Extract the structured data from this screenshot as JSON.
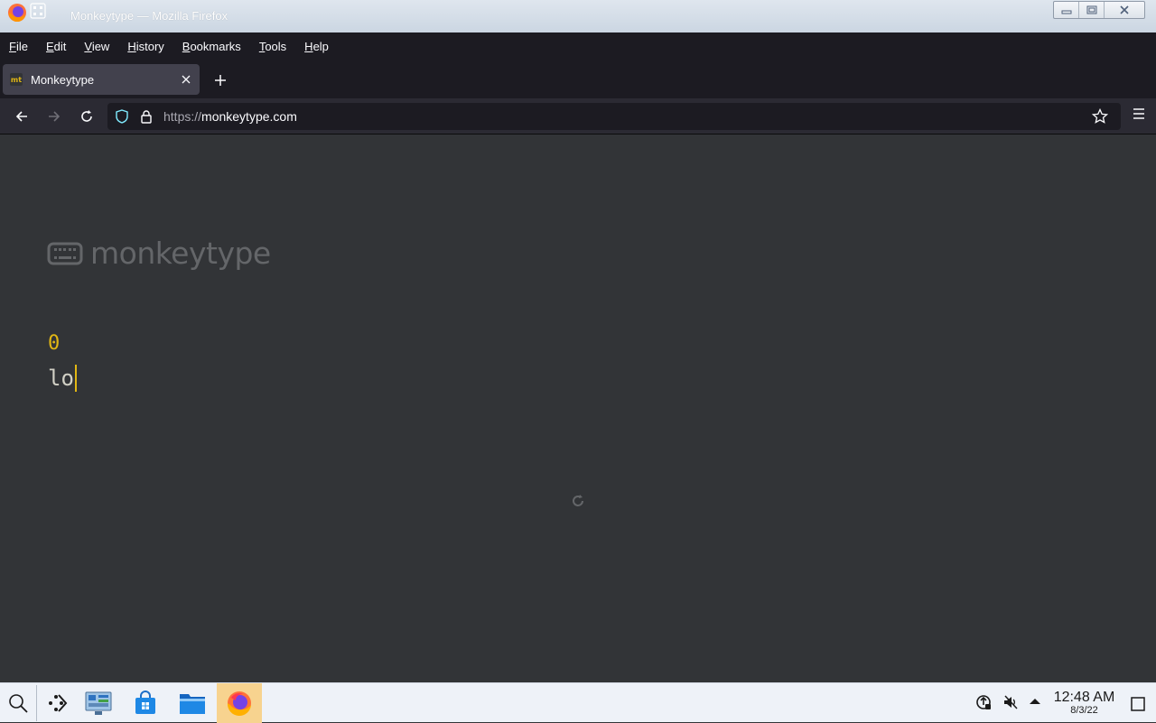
{
  "window": {
    "title": "Monkeytype — Mozilla Firefox"
  },
  "menu": {
    "items": [
      {
        "label": "File"
      },
      {
        "label": "Edit"
      },
      {
        "label": "View"
      },
      {
        "label": "History"
      },
      {
        "label": "Bookmarks"
      },
      {
        "label": "Tools"
      },
      {
        "label": "Help"
      }
    ]
  },
  "tab": {
    "favicon_text": "mt",
    "title": "Monkeytype"
  },
  "urlbar": {
    "scheme": "https://",
    "host": "monkeytype.com"
  },
  "page": {
    "logo_text": "monkeytype",
    "word_count": "0",
    "typed_text": "lo"
  },
  "taskbar": {
    "time": "12:48 AM",
    "date": "8/3/22"
  },
  "colors": {
    "page_background": "#323437",
    "accent": "#e2b714",
    "sub_text": "#646669",
    "main_text": "#d1d0c5",
    "active_task": "#f7d38f"
  },
  "icons": {
    "titlebar": [
      "firefox-icon",
      "grid-icon"
    ],
    "window_controls": [
      "minimize-icon",
      "maximize-icon",
      "close-icon"
    ],
    "nav": [
      "back-icon",
      "forward-icon",
      "reload-icon",
      "shield-icon",
      "lock-icon",
      "star-icon",
      "menu-icon"
    ],
    "taskbar": [
      "search-icon",
      "task-view-icon",
      "control-panel-icon",
      "store-icon",
      "file-manager-icon",
      "firefox-icon"
    ],
    "tray": [
      "network-icon",
      "volume-muted-icon",
      "tray-expand-icon",
      "show-desktop-icon"
    ]
  }
}
